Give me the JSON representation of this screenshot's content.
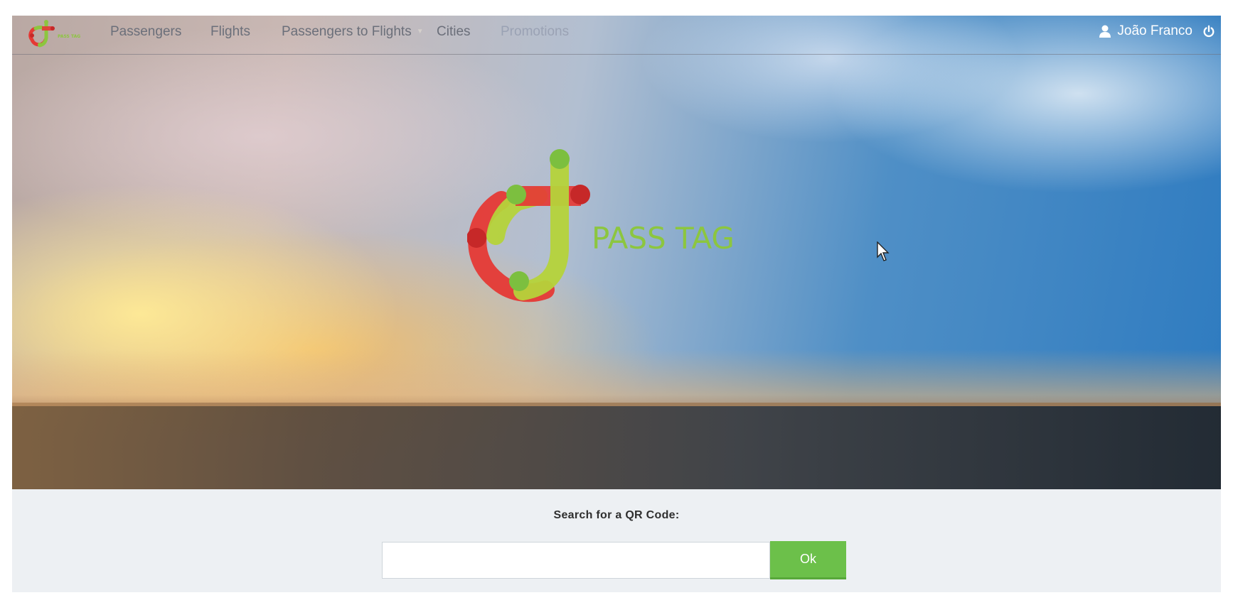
{
  "navbar": {
    "items": [
      {
        "label": "Passengers"
      },
      {
        "label": "Flights"
      },
      {
        "label": "Passengers to Flights",
        "has_dropdown": true
      },
      {
        "label": "Cities"
      },
      {
        "label": "Promotions"
      }
    ],
    "user": {
      "name": "João Franco",
      "icon": "user-icon",
      "logout_icon": "power-icon"
    }
  },
  "hero": {
    "logo_text": "PASS TAG"
  },
  "search": {
    "label": "Search for a QR Code:",
    "input_value": "",
    "input_placeholder": "",
    "button_label": "Ok"
  },
  "colors": {
    "brand_green": "#8cc63f",
    "brand_red": "#e53935",
    "button_green": "#6cc04a",
    "search_bg": "#edf0f3"
  }
}
